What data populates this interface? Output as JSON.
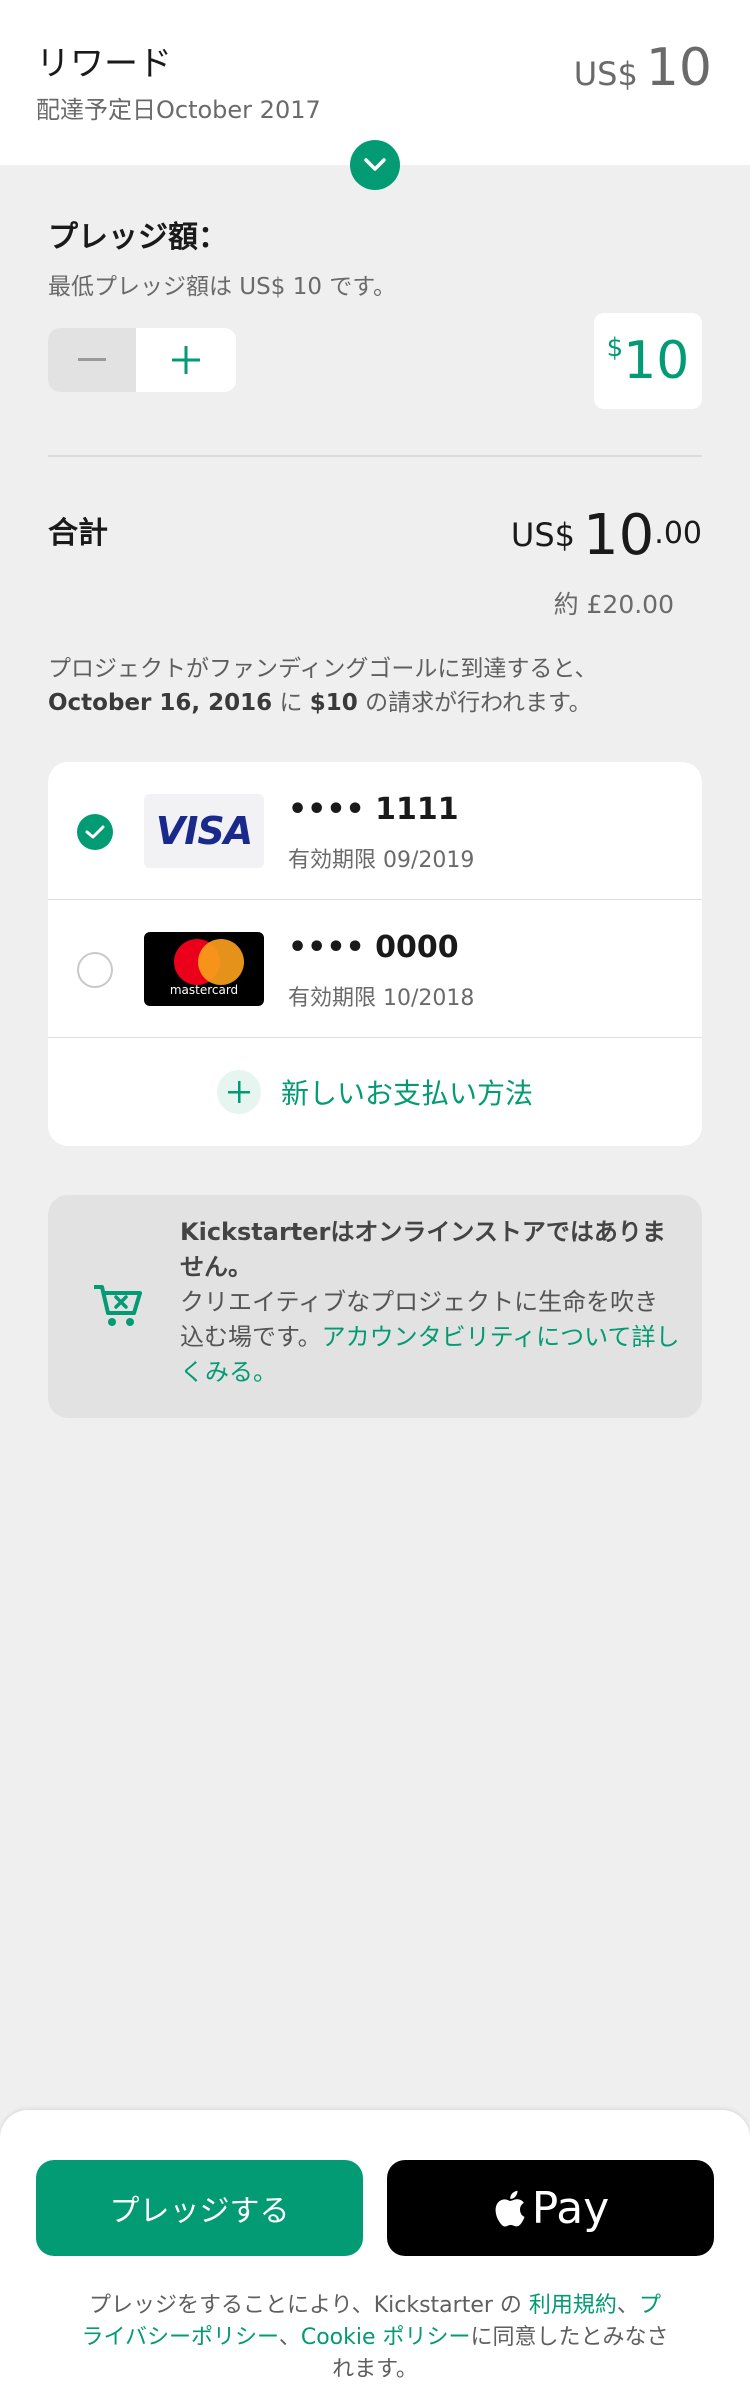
{
  "reward": {
    "title": "リワード",
    "delivery": "配達予定日October 2017",
    "currency": "US$",
    "amount": "10"
  },
  "pledge": {
    "label": "プレッジ額：",
    "min_note": "最低プレッジ額は US$ 10 です。",
    "minus_symbol": "−",
    "plus_symbol": "+",
    "amount_symbol": "$",
    "amount_value": "10"
  },
  "total": {
    "label": "合計",
    "currency": "US$",
    "integer": "10",
    "decimal": ".00",
    "approx": "約 £20.00",
    "note_prefix": "プロジェクトがファンディングゴールに到達すると、",
    "note_date": "October 16, 2016",
    "note_mid": " に ",
    "note_amount": "$10",
    "note_suffix": " の請求が行われます。"
  },
  "payment": {
    "cards": [
      {
        "brand": "VISA",
        "number": "•••• 1111",
        "expiry": "有効期限 09/2019",
        "selected": true
      },
      {
        "brand": "mastercard",
        "number": "•••• 0000",
        "expiry": "有効期限 10/2018",
        "selected": false
      }
    ],
    "add_label": "新しいお支払い方法"
  },
  "info": {
    "bold_line": "Kickstarterはオンラインストアではありません。",
    "text": "クリエイティブなプロジェクトに生命を吹き込む場です。",
    "link": "アカウンタビリティについて詳しくみる。"
  },
  "actions": {
    "pledge_button": "プレッジする",
    "applepay_label": "Pay",
    "terms_prefix": "プレッジをすることにより、Kickstarter の ",
    "terms_link1": "利用規約",
    "terms_sep1": "、",
    "terms_link2": "プライバシーポリシー",
    "terms_sep2": "、",
    "terms_link3": "Cookie ポリシー",
    "terms_suffix": "に同意したとみなされます。"
  },
  "colors": {
    "accent": "#039b73",
    "background": "#efefef",
    "info_bg": "#e2e2e2"
  },
  "icons": [
    "chevron-down-icon",
    "minus-icon",
    "plus-icon",
    "check-icon",
    "cart-x-icon",
    "apple-icon"
  ]
}
